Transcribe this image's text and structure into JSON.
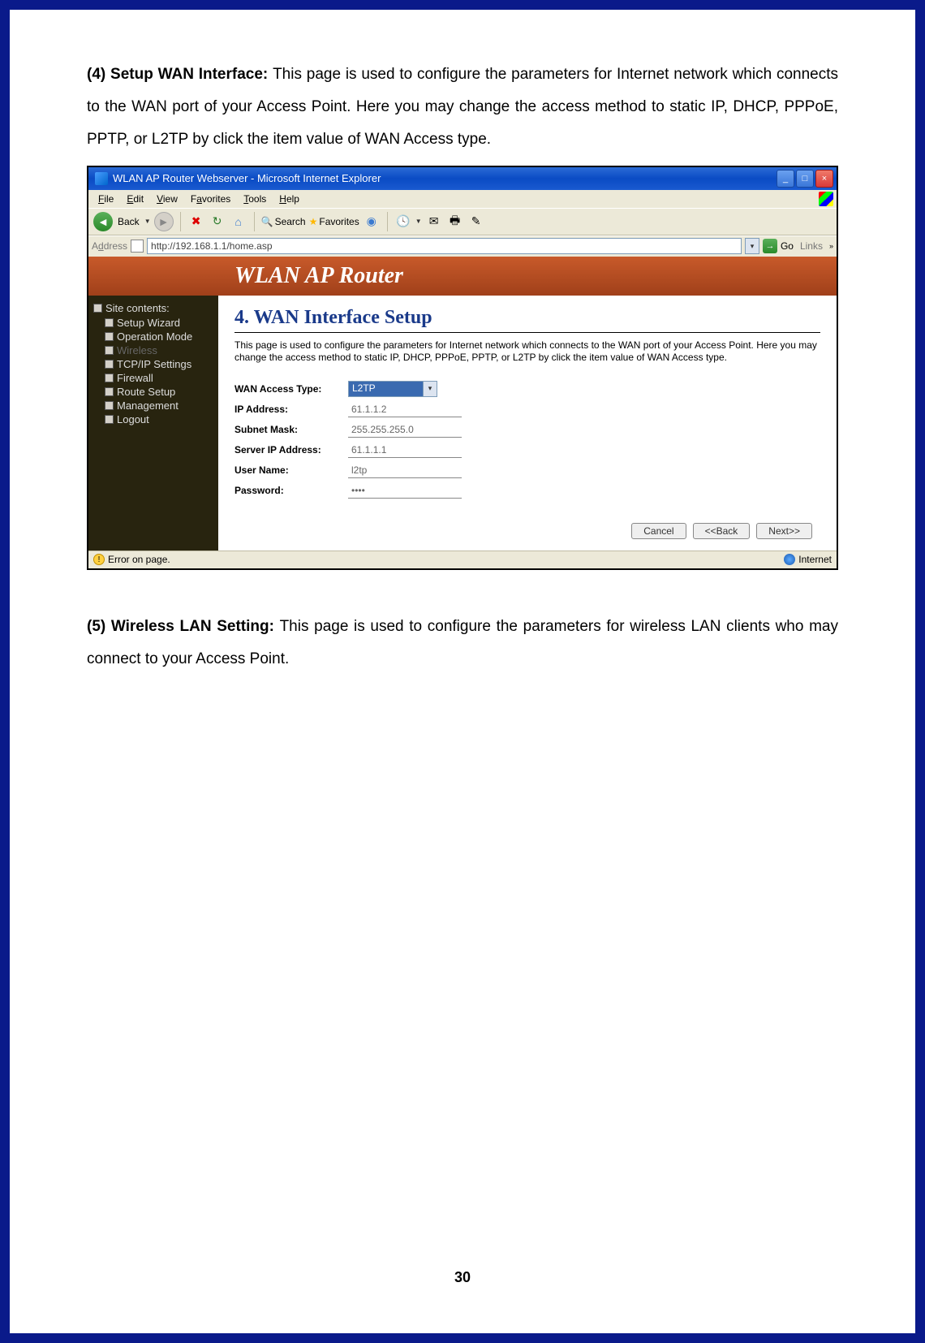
{
  "section4": {
    "heading": "(4) Setup WAN Interface: ",
    "text": "This page is used to configure the parameters for Internet network which connects to the WAN port of your Access Point. Here you may change the access method to static IP, DHCP, PPPoE, PPTP, or L2TP by click the item value of WAN Access type."
  },
  "ie": {
    "title": "WLAN AP Router Webserver - Microsoft Internet Explorer",
    "menu": {
      "file": "File",
      "edit": "Edit",
      "view": "View",
      "favorites": "Favorites",
      "tools": "Tools",
      "help": "Help"
    },
    "toolbar": {
      "back": "Back",
      "search": "Search",
      "favorites": "Favorites"
    },
    "address_label": "Address",
    "address_value": "http://192.168.1.1/home.asp",
    "go": "Go",
    "links": "Links",
    "status_left": "Error on page.",
    "status_right": "Internet"
  },
  "router": {
    "brand": "WLAN AP Router",
    "sidebar_header": "Site contents:",
    "sidebar": [
      "Setup Wizard",
      "Operation Mode",
      "Wireless",
      "TCP/IP Settings",
      "Firewall",
      "Route Setup",
      "Management",
      "Logout"
    ],
    "panel": {
      "title": "4. WAN Interface Setup",
      "desc": "This page is used to configure the parameters for Internet network which connects to the WAN port of your Access Point. Here you may change the access method to static IP, DHCP, PPPoE, PPTP, or L2TP by click the item value of WAN Access type.",
      "fields": {
        "wan_access_type_label": "WAN Access Type:",
        "wan_access_type_value": "L2TP",
        "ip_label": "IP Address:",
        "ip_value": "61.1.1.2",
        "mask_label": "Subnet Mask:",
        "mask_value": "255.255.255.0",
        "server_label": "Server IP Address:",
        "server_value": "61.1.1.1",
        "user_label": "User Name:",
        "user_value": "l2tp",
        "pass_label": "Password:",
        "pass_value": "••••"
      },
      "buttons": {
        "cancel": "Cancel",
        "back": "<<Back",
        "next": "Next>>"
      }
    }
  },
  "section5": {
    "heading": "(5) Wireless LAN Setting: ",
    "text": "This page is used to configure the parameters for wireless LAN clients who may connect to your Access Point."
  },
  "page_number": "30"
}
